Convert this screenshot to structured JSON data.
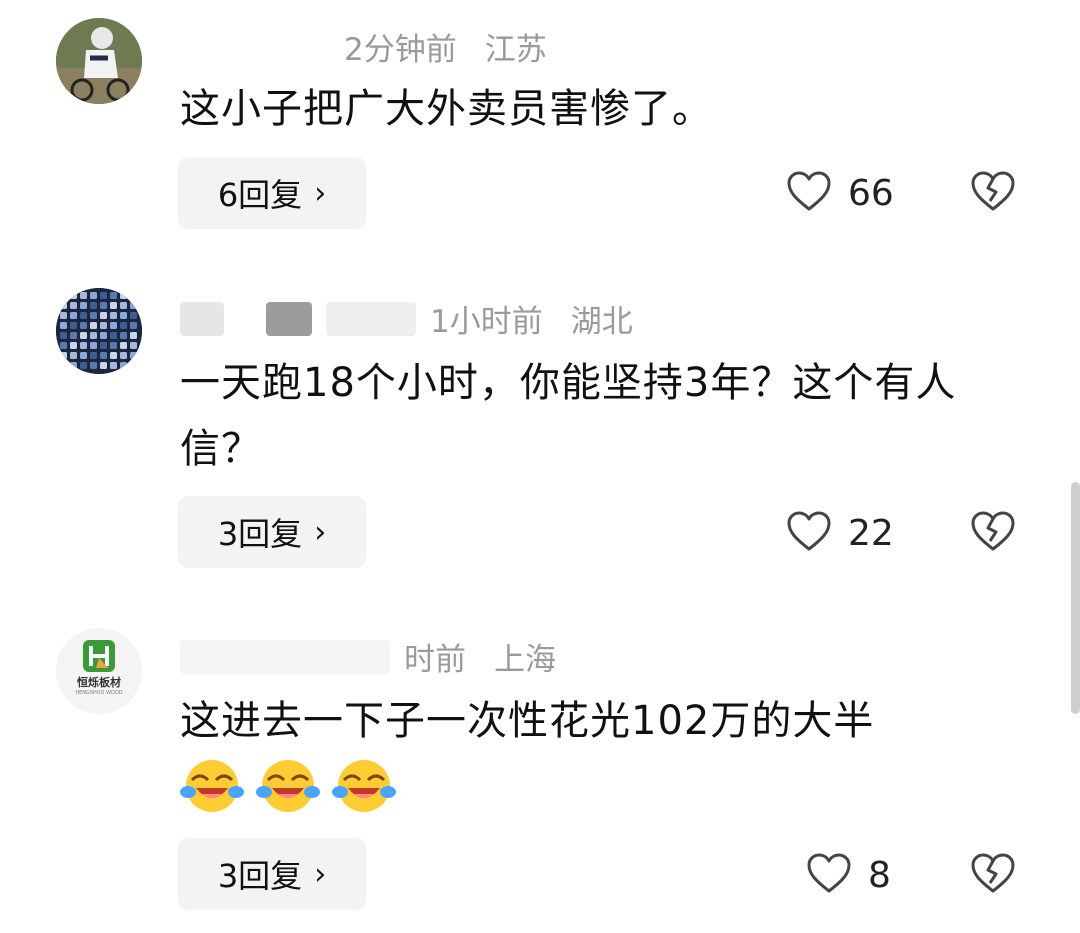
{
  "comments": [
    {
      "time": "2分钟前",
      "location": "江苏",
      "text": "这小子把广大外卖员害惨了。",
      "reply_label": "6回复",
      "likes": "66"
    },
    {
      "time": "1小时前",
      "location": "湖北",
      "text": "一天跑18个小时，你能坚持3年？这个有人信？",
      "reply_label": "3回复",
      "likes": "22"
    },
    {
      "time": "时前",
      "location": "上海",
      "text": "这进去一下子一次性花光102万的大半",
      "reply_label": "3回复",
      "likes": "8",
      "avatar_brand": "恒烁板材",
      "avatar_brand_sub": "HENGSHUO WOOD",
      "emoji_count": 3
    }
  ],
  "icons": {
    "like": "heart-outline-icon",
    "dislike": "broken-heart-icon",
    "chevron": "chevron-right-icon"
  },
  "colors": {
    "meta_text": "#9a9a9a",
    "reply_bg": "#f3f3f4",
    "brand_green": "#3a9a3a"
  }
}
